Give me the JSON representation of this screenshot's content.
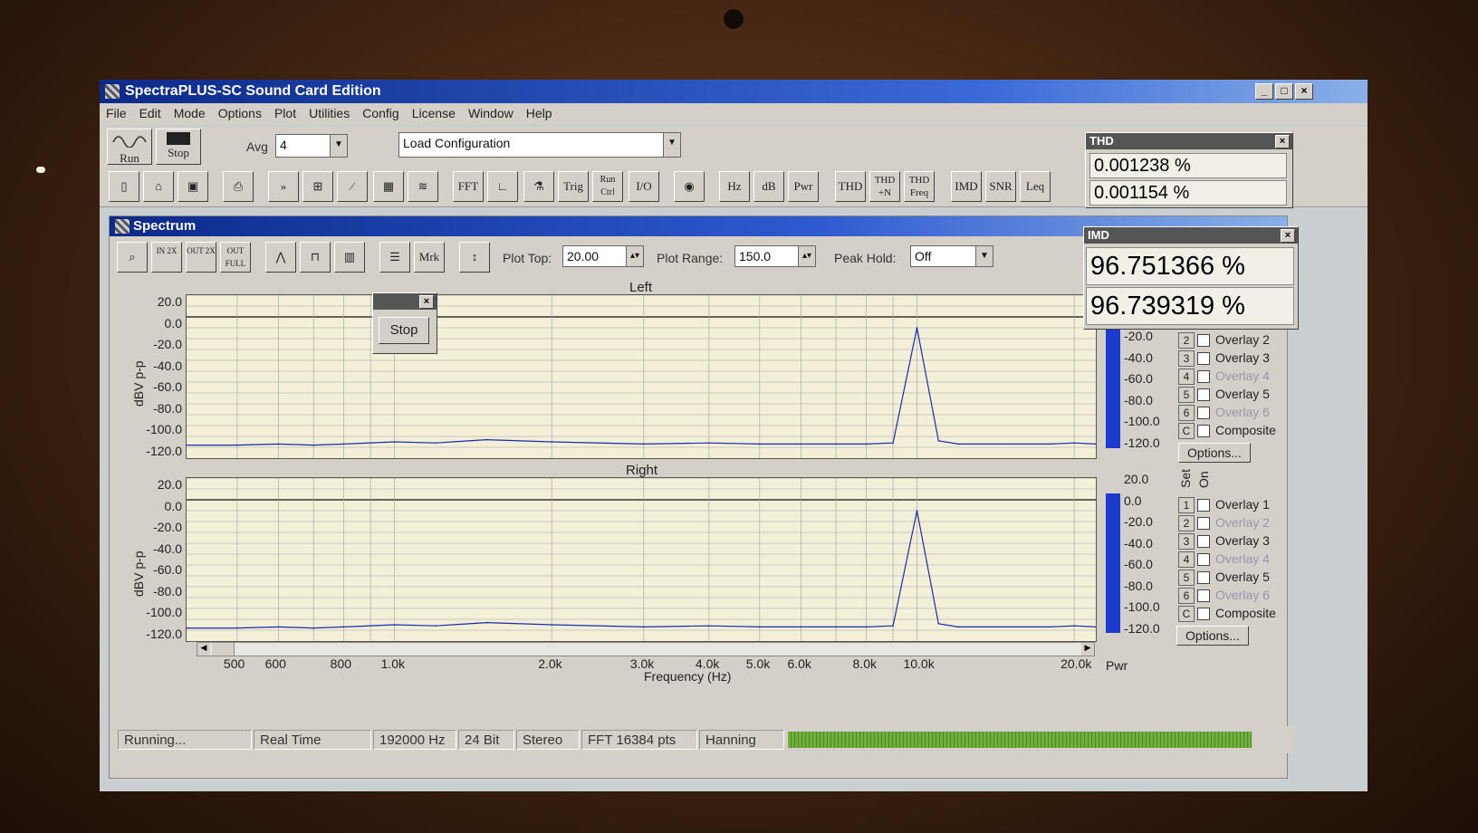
{
  "app": {
    "title": "SpectraPLUS-SC Sound Card Edition"
  },
  "menu": [
    "File",
    "Edit",
    "Mode",
    "Options",
    "Plot",
    "Utilities",
    "Config",
    "License",
    "Window",
    "Help"
  ],
  "toolbar": {
    "run_label": "Run",
    "stop_label": "Stop",
    "avg_label": "Avg",
    "avg_value": "4",
    "config_value": "Load Configuration",
    "buttons": [
      "FFT",
      "Trig",
      "Run Ctrl",
      "I/O",
      "Hz",
      "dB",
      "Pwr",
      "THD",
      "THD +N",
      "THD Freq",
      "IMD",
      "SNR",
      "Leq"
    ]
  },
  "spectrum": {
    "title": "Spectrum",
    "zoom_in": "IN 2X",
    "zoom_out": "OUT 2X",
    "zoom_full": "OUT FULL",
    "mrk": "Mrk",
    "plot_top_label": "Plot Top:",
    "plot_top_value": "20.00",
    "plot_range_label": "Plot Range:",
    "plot_range_value": "150.0",
    "peak_hold_label": "Peak Hold:",
    "peak_hold_value": "Off",
    "left_label": "Left",
    "right_label": "Right",
    "y_axis_label": "dBV p-p",
    "x_axis_label": "Frequency (Hz)",
    "pwr_label": "Pwr",
    "y_ticks": [
      "20.0",
      "0.0",
      "-20.0",
      "-40.0",
      "-60.0",
      "-80.0",
      "-100.0",
      "-120.0"
    ],
    "meter_ticks_top": [
      "-20.0",
      "-40.0",
      "-60.0",
      "-80.0",
      "-100.0",
      "-120.0"
    ],
    "meter_ticks_bottom": [
      "20.0",
      "0.0",
      "-20.0",
      "-40.0",
      "-60.0",
      "-80.0",
      "-100.0",
      "-120.0"
    ],
    "x_ticks": [
      "500",
      "600",
      "800",
      "1.0k",
      "2.0k",
      "3.0k",
      "4.0k",
      "5.0k",
      "6.0k",
      "8.0k",
      "10.0k",
      "20.0k"
    ],
    "set_label": "Set",
    "on_label": "On",
    "options_label": "Options...",
    "overlays_top": [
      {
        "num": "2",
        "label": "Overlay 2",
        "dim": false
      },
      {
        "num": "3",
        "label": "Overlay 3",
        "dim": false
      },
      {
        "num": "4",
        "label": "Overlay 4",
        "dim": true
      },
      {
        "num": "5",
        "label": "Overlay 5",
        "dim": false
      },
      {
        "num": "6",
        "label": "Overlay 6",
        "dim": true
      },
      {
        "num": "C",
        "label": "Composite",
        "dim": false
      }
    ],
    "overlays_bottom": [
      {
        "num": "1",
        "label": "Overlay 1",
        "dim": false
      },
      {
        "num": "2",
        "label": "Overlay 2",
        "dim": true
      },
      {
        "num": "3",
        "label": "Overlay 3",
        "dim": false
      },
      {
        "num": "4",
        "label": "Overlay 4",
        "dim": true
      },
      {
        "num": "5",
        "label": "Overlay 5",
        "dim": false
      },
      {
        "num": "6",
        "label": "Overlay 6",
        "dim": true
      },
      {
        "num": "C",
        "label": "Composite",
        "dim": false
      }
    ]
  },
  "stop_popup": {
    "label": "Stop"
  },
  "thd": {
    "title": "THD",
    "left": "0.001238 %",
    "right": "0.001154 %"
  },
  "imd": {
    "title": "IMD",
    "left": "96.751366 %",
    "right": "96.739319 %"
  },
  "status": [
    "Running...",
    "Real Time",
    "192000 Hz",
    "24 Bit",
    "Stereo",
    "FFT 16384 pts",
    "Hanning"
  ],
  "chart_data": [
    {
      "type": "line",
      "title": "Left",
      "xlabel": "Frequency (Hz)",
      "ylabel": "dBV p-p",
      "x_scale": "log",
      "ylim": [
        -130,
        20
      ],
      "grid": true,
      "x": [
        400,
        500,
        600,
        700,
        800,
        1000,
        1200,
        1500,
        2000,
        3000,
        4000,
        5000,
        6000,
        7000,
        8000,
        9000,
        10000,
        11000,
        12000,
        15000,
        18000,
        20000,
        22000
      ],
      "y": [
        -118,
        -118,
        -117,
        -118,
        -117,
        -115,
        -116,
        -113,
        -115,
        -117,
        -116,
        -117,
        -117,
        -117,
        -117,
        -116,
        -10,
        -114,
        -117,
        -117,
        -117,
        -116,
        -117
      ]
    },
    {
      "type": "line",
      "title": "Right",
      "xlabel": "Frequency (Hz)",
      "ylabel": "dBV p-p",
      "x_scale": "log",
      "ylim": [
        -130,
        20
      ],
      "grid": true,
      "x": [
        400,
        500,
        600,
        700,
        800,
        1000,
        1200,
        1500,
        2000,
        3000,
        4000,
        5000,
        6000,
        7000,
        8000,
        9000,
        10000,
        11000,
        12000,
        15000,
        18000,
        20000,
        22000
      ],
      "y": [
        -118,
        -118,
        -117,
        -118,
        -117,
        -115,
        -116,
        -113,
        -115,
        -117,
        -116,
        -117,
        -117,
        -117,
        -117,
        -116,
        -10,
        -114,
        -117,
        -117,
        -117,
        -116,
        -117
      ]
    }
  ]
}
